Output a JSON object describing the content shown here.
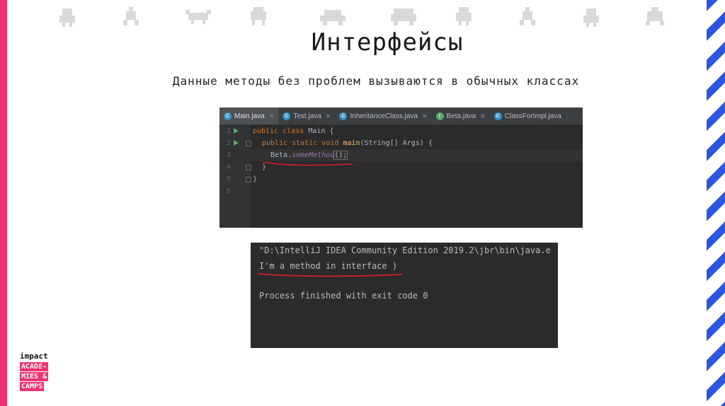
{
  "slide": {
    "title": "Интерфейсы",
    "subtitle": "Данные методы без проблем вызываются в обычных классах"
  },
  "ide": {
    "tabs": [
      {
        "label": "Main.java",
        "icon": "class-icon",
        "icon_letter": "C",
        "color": "#3592c4",
        "active": true
      },
      {
        "label": "Test.java",
        "icon": "class-icon",
        "icon_letter": "C",
        "color": "#3592c4",
        "active": false
      },
      {
        "label": "InheritanceClass.java",
        "icon": "class-icon",
        "icon_letter": "C",
        "color": "#3592c4",
        "active": false
      },
      {
        "label": "Beta.java",
        "icon": "interface-icon",
        "icon_letter": "I",
        "color": "#59a869",
        "active": false
      },
      {
        "label": "ClassForImpl.java",
        "icon": "class-icon",
        "icon_letter": "C",
        "color": "#3592c4",
        "active": false
      }
    ],
    "line_numbers": [
      "1",
      "2",
      "3",
      "4",
      "5",
      "6"
    ],
    "code": {
      "l1_kw": "public class ",
      "l1_rest": "Main {",
      "l2_kw": "public static void ",
      "l2_fn": "main",
      "l2_rest": "(String[] Args) {",
      "l3_obj": "Beta.",
      "l3_method": "someMethod",
      "l3_rest": "();",
      "l4": "}",
      "l5": "}"
    }
  },
  "console": {
    "lines": [
      "\"D:\\IntelliJ IDEA Community Edition 2019.2\\jbr\\bin\\java.e",
      "I'm a method in interface )",
      "",
      "Process finished with exit code 0"
    ]
  },
  "logo": {
    "top": "impact",
    "lines": [
      "ACADE-",
      "MIES &",
      "CAMPS"
    ]
  },
  "colors": {
    "accent_pink": "#ee3270",
    "stripe_blue": "#2b56e0",
    "annotation_red": "#d41f2b"
  }
}
